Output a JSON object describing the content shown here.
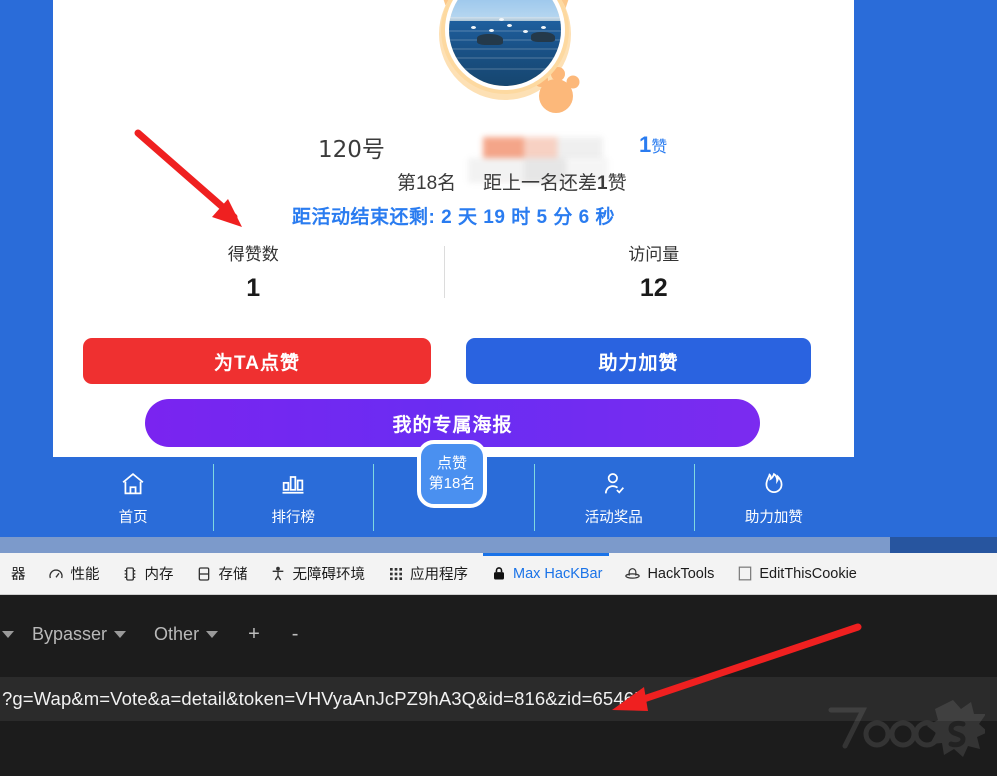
{
  "profile": {
    "number_label": "120号",
    "like_count_inline": "1",
    "like_unit": "赞",
    "rank_label": "第18名",
    "gap_text_prefix": "距上一名还差",
    "gap_count": "1",
    "gap_suffix": "赞",
    "countdown": "距活动结束还剩: 2 天 19 时 5 分 6 秒",
    "avatar_alt": "海边风景头像"
  },
  "stats": [
    {
      "label": "得赞数",
      "value": "1",
      "name": "likes"
    },
    {
      "label": "访问量",
      "value": "12",
      "name": "visits"
    }
  ],
  "buttons": {
    "vote": "为TA点赞",
    "boost": "助力加赞",
    "poster": "我的专属海报"
  },
  "floating_badge": {
    "line1": "点赞",
    "line2": "第18名"
  },
  "bottom_nav": [
    {
      "label": "首页",
      "icon": "home-icon"
    },
    {
      "label": "排行榜",
      "icon": "bar-chart-icon"
    },
    {
      "label": "",
      "icon": "center-placeholder"
    },
    {
      "label": "活动奖品",
      "icon": "person-check-icon"
    },
    {
      "label": "助力加赞",
      "icon": "flame-icon"
    }
  ],
  "devtools_tabs": [
    {
      "label": "器",
      "icon": "clipped-tab-icon",
      "active": false
    },
    {
      "label": "性能",
      "icon": "gauge-icon",
      "active": false
    },
    {
      "label": "内存",
      "icon": "memory-chip-icon",
      "active": false
    },
    {
      "label": "存储",
      "icon": "database-icon",
      "active": false
    },
    {
      "label": "无障碍环境",
      "icon": "accessibility-icon",
      "active": false
    },
    {
      "label": "应用程序",
      "icon": "grid-apps-icon",
      "active": false
    },
    {
      "label": "Max HacKBar",
      "icon": "lock-icon",
      "active": true
    },
    {
      "label": "HackTools",
      "icon": "hat-icon",
      "active": false
    },
    {
      "label": "EditThisCookie",
      "icon": "cookie-square-icon",
      "active": false
    }
  ],
  "hackbar": {
    "bypasser_label": "Bypasser",
    "other_label": "Other",
    "add_label": "+",
    "remove_label": "-",
    "url_value": "?g=Wap&m=Vote&a=detail&token=VHVyaAnJcPZ9hA3Q&id=816&zid=65465"
  },
  "watermark": {
    "text": "7oo6s"
  },
  "colors": {
    "page_blue": "#2a6cd9",
    "accent_blue": "#2a7cf0",
    "vote_red": "#ef3030",
    "boost_blue": "#2a63e0",
    "poster_purple": "#7a24f0",
    "arrow_red": "#ef2020",
    "devtools_active": "#1a73e8"
  }
}
